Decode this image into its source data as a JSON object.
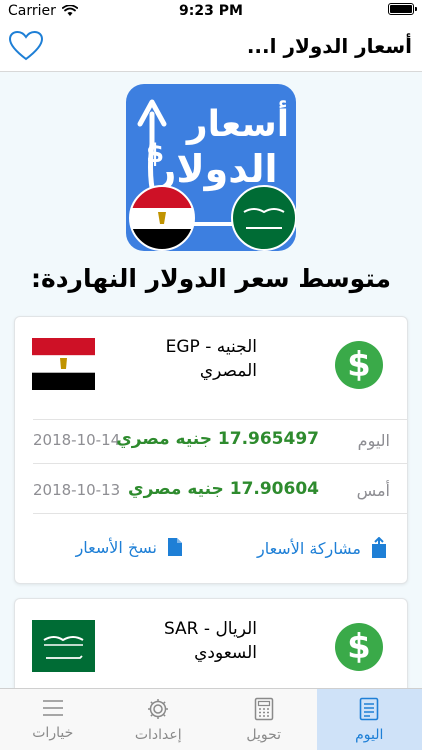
{
  "status_bar": {
    "carrier": "Carrier",
    "time": "9:23 PM"
  },
  "nav": {
    "title": "أسعار الدولار ا..."
  },
  "hero": {
    "logo_line1": "أسعار",
    "logo_line2": "الدولار",
    "logo_symbol": "$"
  },
  "headline": "متوسط سعر الدولار النهاردة:",
  "cards": [
    {
      "name_line1": "الجنيه - EGP",
      "name_line2": "المصري",
      "symbol": "$",
      "today": {
        "label": "اليوم",
        "price": "17.965497 جنيه مصري",
        "date": "2018-10-14"
      },
      "yesterday": {
        "label": "أمس",
        "price": "17.90604 جنيه مصري",
        "date": "2018-10-13"
      },
      "share_label": "مشاركة الأسعار",
      "copy_label": "نسخ الأسعار"
    },
    {
      "name_line1": "الريال - SAR",
      "name_line2": "السعودي",
      "symbol": "$"
    }
  ],
  "tabs": [
    {
      "label": "خيارات",
      "icon": "menu-lines-icon",
      "active": false
    },
    {
      "label": "إعدادات",
      "icon": "gear-icon",
      "active": false
    },
    {
      "label": "تحويل",
      "icon": "calculator-icon",
      "active": false
    },
    {
      "label": "اليوم",
      "icon": "document-icon",
      "active": true
    }
  ],
  "colors": {
    "accent": "#1e7fd6",
    "green": "#3aaa49",
    "price_green": "#2e8b2e",
    "background": "#f2f9fc"
  }
}
